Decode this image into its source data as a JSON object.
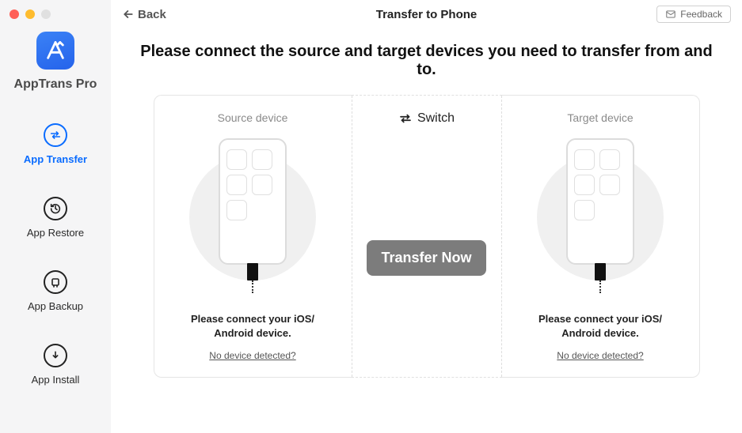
{
  "app": {
    "name": "AppTrans Pro"
  },
  "sidebar": {
    "items": [
      {
        "label": "App Transfer",
        "icon": "transfer-icon",
        "active": true
      },
      {
        "label": "App Restore",
        "icon": "restore-icon",
        "active": false
      },
      {
        "label": "App Backup",
        "icon": "backup-icon",
        "active": false
      },
      {
        "label": "App Install",
        "icon": "install-icon",
        "active": false
      }
    ]
  },
  "header": {
    "back_label": "Back",
    "title": "Transfer to Phone",
    "feedback_label": "Feedback"
  },
  "headline": "Please connect the source and target devices you need to transfer from and to.",
  "center": {
    "switch_label": "Switch",
    "transfer_label": "Transfer Now"
  },
  "devices": {
    "source": {
      "heading": "Source device",
      "prompt_line1": "Please connect your iOS/",
      "prompt_line2": "Android device.",
      "help_link": "No device detected?"
    },
    "target": {
      "heading": "Target device",
      "prompt_line1": "Please connect your iOS/",
      "prompt_line2": "Android device.",
      "help_link": "No device detected?"
    }
  }
}
